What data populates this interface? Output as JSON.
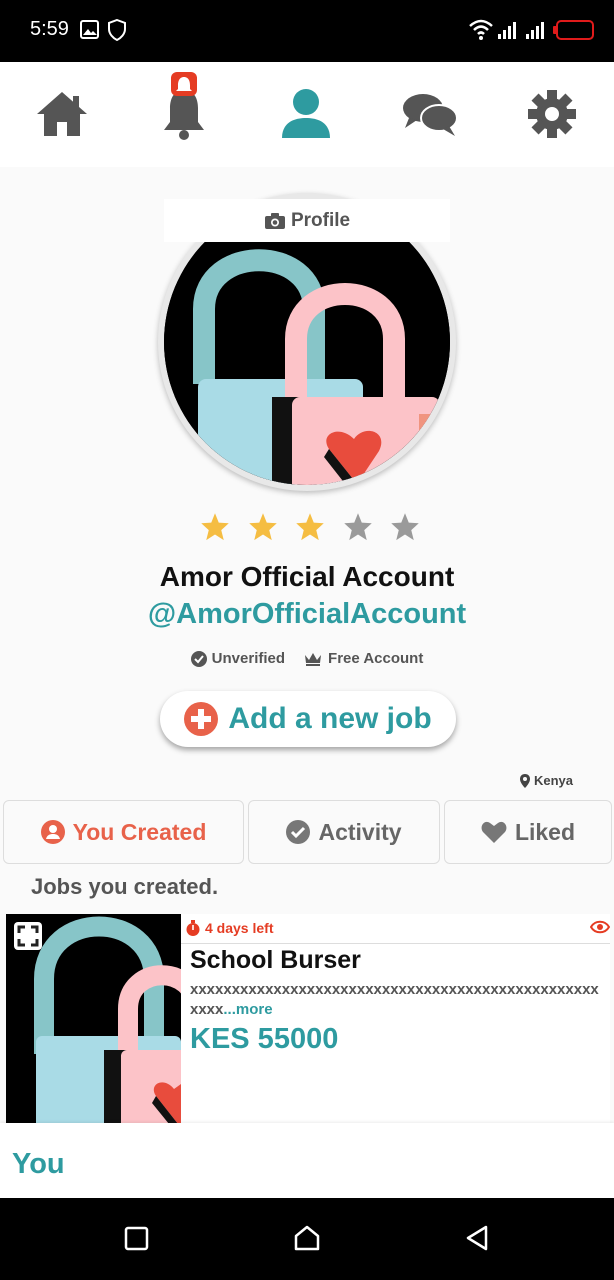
{
  "status_bar": {
    "time": "5:59"
  },
  "nav": {
    "items": [
      "home-icon",
      "notifications-icon",
      "profile-icon",
      "messages-icon",
      "settings-icon"
    ],
    "active": "profile-icon"
  },
  "profile": {
    "photo_label": "Profile",
    "rating": 3,
    "rating_max": 5,
    "display_name": "Amor Official Account",
    "username": "@AmorOfficialAccount",
    "verification": "Unverified",
    "account_type": "Free Account"
  },
  "add_job": {
    "label": "Add a new job"
  },
  "location": "Kenya",
  "tabs": [
    {
      "label": "You Created",
      "icon": "user-circle-icon",
      "active": true
    },
    {
      "label": "Activity",
      "icon": "check-circle-icon",
      "active": false
    },
    {
      "label": "Liked",
      "icon": "heart-icon",
      "active": false
    }
  ],
  "section_heading": "Jobs you created.",
  "jobs": [
    {
      "time_left": "4 days left",
      "title": "School Burser",
      "description": "xxxxxxxxxxxxxxxxxxxxxxxxxxxxxxxxxxxxxxxxxxxxxxxxxxxxx",
      "more_label": "...more",
      "price": "KES 55000"
    }
  ],
  "bottom_sheet": {
    "label": "You"
  },
  "colors": {
    "accent": "#2e9ba0",
    "danger": "#e53c23",
    "active_tab": "#e8624a",
    "star_on": "#f5bd42",
    "star_off": "#9a9a9a"
  }
}
